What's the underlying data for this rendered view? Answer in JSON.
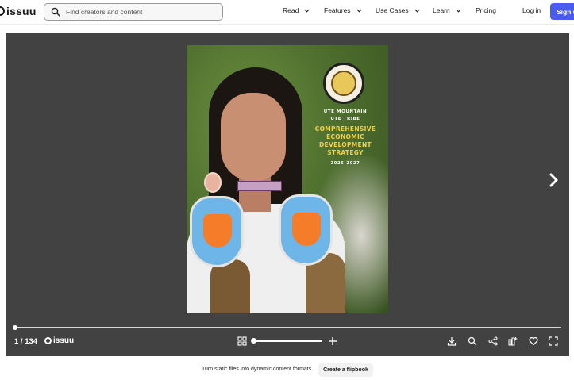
{
  "header": {
    "logo_text": "issuu",
    "search_placeholder": "Find creators and content",
    "nav": [
      {
        "label": "Read",
        "has_dropdown": true
      },
      {
        "label": "Features",
        "has_dropdown": true
      },
      {
        "label": "Use Cases",
        "has_dropdown": true
      },
      {
        "label": "Learn",
        "has_dropdown": true
      },
      {
        "label": "Pricing",
        "has_dropdown": false
      }
    ],
    "login_label": "Log in",
    "signup_label": "Sign u",
    "accent_color": "#4a5cf0"
  },
  "cover": {
    "tribe_line1": "UTE MOUNTAIN",
    "tribe_line2": "UTE TRIBE",
    "title_line1": "COMPREHENSIVE",
    "title_line2": "ECONOMIC",
    "title_line3": "DEVELOPMENT",
    "title_line4": "STRATEGY",
    "years": "2026-2027",
    "title_color": "#f2d04a"
  },
  "viewer": {
    "page_counter": "1 / 134",
    "brand_text": "issuu",
    "background_color": "#424242",
    "icons": [
      "grid-icon",
      "zoom-in-icon",
      "download-icon",
      "search-icon",
      "share-icon",
      "embed-icon",
      "heart-icon",
      "fullscreen-icon",
      "next-page-icon"
    ]
  },
  "footer": {
    "tagline": "Turn static files into dynamic content formats.",
    "cta_label": "Create a flipbook"
  }
}
